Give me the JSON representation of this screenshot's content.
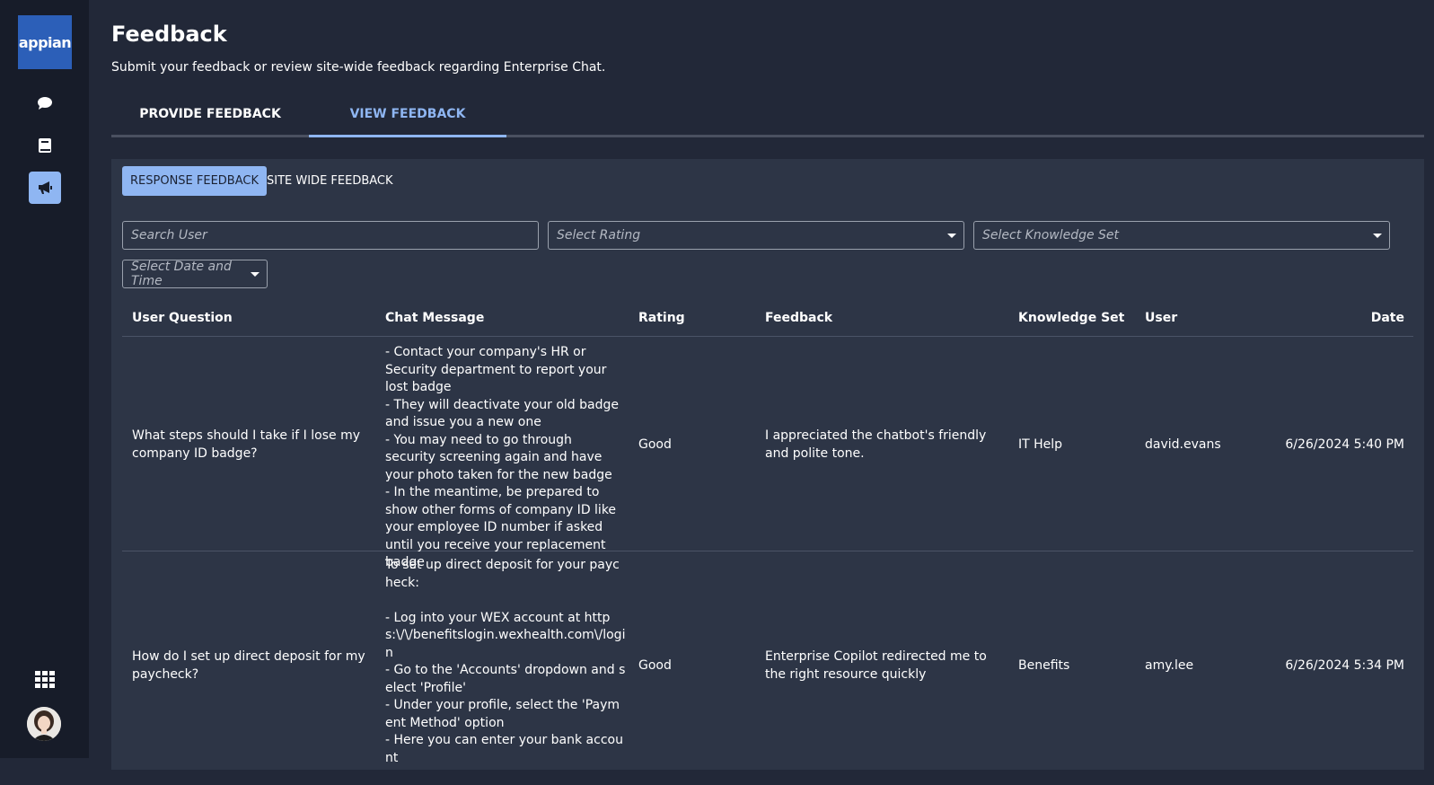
{
  "app": {
    "logo_text": "appian",
    "brand_color": "#2c5fb8",
    "accent_color": "#8fb6f2"
  },
  "rail": {
    "items": [
      {
        "icon": "chat-bubble-icon",
        "active": false
      },
      {
        "icon": "book-icon",
        "active": false
      },
      {
        "icon": "megaphone-icon",
        "active": true
      }
    ],
    "bottom": [
      {
        "icon": "app-grid-icon"
      },
      {
        "icon": "user-avatar"
      }
    ]
  },
  "header": {
    "title": "Feedback",
    "subtitle": "Submit your feedback or review site-wide feedback regarding Enterprise Chat."
  },
  "tabs": [
    {
      "label": "PROVIDE FEEDBACK",
      "active": false
    },
    {
      "label": "VIEW FEEDBACK",
      "active": true
    }
  ],
  "subtabs": [
    {
      "label": "RESPONSE FEEDBACK",
      "active": true
    },
    {
      "label": "SITE WIDE FEEDBACK",
      "active": false
    }
  ],
  "filters": {
    "search_user_placeholder": "Search User",
    "rating_placeholder": "Select Rating",
    "knowledge_set_placeholder": "Select Knowledge Set",
    "date_placeholder": "Select Date and Time"
  },
  "table": {
    "columns": [
      "User Question",
      "Chat Message",
      "Rating",
      "Feedback",
      "Knowledge Set",
      "User",
      "Date"
    ],
    "rows": [
      {
        "question": "What steps should I take if I lose my company ID badge?",
        "message": "- Contact your company's HR or Security department to report your lost badge\n- They will deactivate your old badge and issue you a new one\n- You may need to go through security screening again and have your photo taken for the new badge\n- In the meantime, be prepared to show other forms of company ID like your employee ID number if asked until you receive your replacement badge",
        "rating": "Good",
        "feedback": "I appreciated the chatbot's friendly and polite tone.",
        "knowledge_set": "IT Help",
        "user": "david.evans",
        "date": "6/26/2024 5:40 PM"
      },
      {
        "question": "How do I set up direct deposit for my paycheck?",
        "message": "To set up direct deposit for your paycheck:\n\n- Log into your WEX account at https:\\/\\/benefitslogin.wexhealth.com\\/login\n- Go to the 'Accounts' dropdown and select 'Profile'\n- Under your profile, select the 'Payment Method' option\n- Here you can enter your bank account",
        "rating": "Good",
        "feedback": "Enterprise Copilot redirected me to the right resource quickly",
        "knowledge_set": "Benefits",
        "user": "amy.lee",
        "date": "6/26/2024 5:34 PM"
      }
    ]
  }
}
